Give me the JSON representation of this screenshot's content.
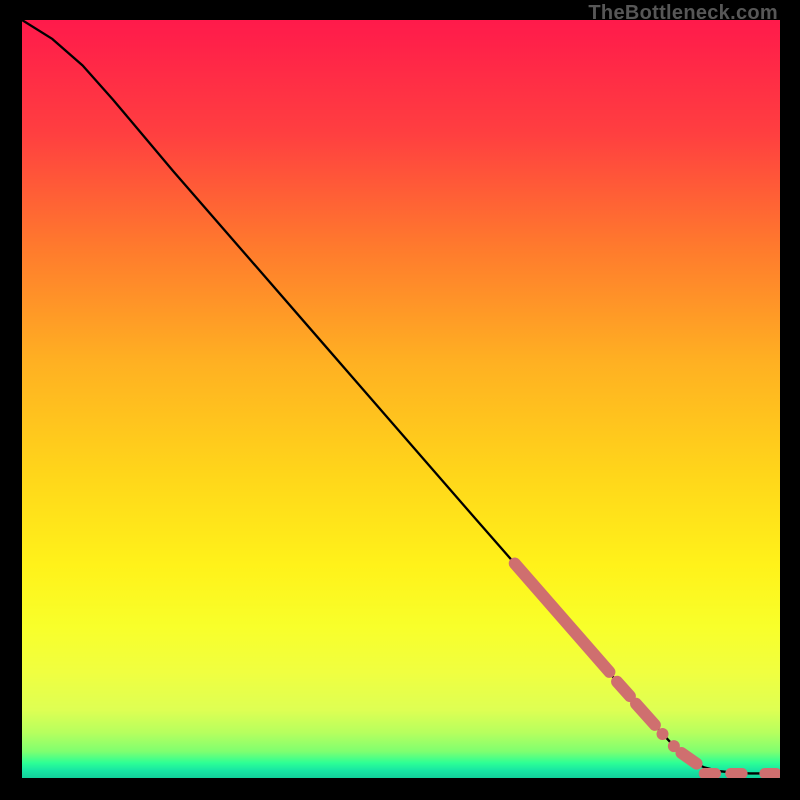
{
  "brand": "TheBottleneck.com",
  "chart_data": {
    "type": "line",
    "title": "",
    "xlabel": "",
    "ylabel": "",
    "xlim": [
      0,
      100
    ],
    "ylim": [
      0,
      100
    ],
    "grid": false,
    "legend": false,
    "series": [
      {
        "name": "curve",
        "x": [
          0,
          4,
          8,
          12,
          20,
          30,
          40,
          50,
          60,
          65,
          70,
          72,
          74,
          76,
          78,
          80,
          82,
          84,
          85,
          86,
          87,
          88,
          89,
          90,
          92,
          94,
          96,
          98,
          100
        ],
        "y": [
          100,
          97.5,
          94.0,
          89.5,
          80.0,
          68.5,
          57.0,
          45.5,
          34.0,
          28.3,
          22.5,
          20.2,
          17.9,
          15.6,
          13.3,
          11.0,
          8.7,
          6.4,
          5.3,
          4.2,
          3.3,
          2.5,
          1.9,
          1.4,
          0.9,
          0.7,
          0.6,
          0.6,
          0.6
        ],
        "color": "#000000",
        "stroke_width": 2.3
      }
    ],
    "markers": [
      {
        "name": "run-segment-1",
        "color": "#cf6f6f",
        "stroke_width": 12,
        "cap": "round",
        "points_x": [
          65.0,
          77.5
        ],
        "points_y": [
          28.3,
          14.0
        ]
      },
      {
        "name": "run-segment-2",
        "color": "#cf6f6f",
        "stroke_width": 12,
        "cap": "round",
        "points_x": [
          78.5,
          80.2
        ],
        "points_y": [
          12.7,
          10.8
        ]
      },
      {
        "name": "run-segment-3",
        "color": "#cf6f6f",
        "stroke_width": 12,
        "cap": "round",
        "points_x": [
          81.0,
          83.5
        ],
        "points_y": [
          9.8,
          7.0
        ]
      },
      {
        "name": "dot-1",
        "shape": "circle",
        "color": "#cf6f6f",
        "r": 6,
        "cx": 84.5,
        "cy": 5.8
      },
      {
        "name": "dot-2",
        "shape": "circle",
        "color": "#cf6f6f",
        "r": 6,
        "cx": 86.0,
        "cy": 4.2
      },
      {
        "name": "run-segment-4",
        "color": "#cf6f6f",
        "stroke_width": 12,
        "cap": "round",
        "points_x": [
          87.0,
          89.0
        ],
        "points_y": [
          3.3,
          1.9
        ]
      },
      {
        "name": "dash-1",
        "color": "#cf6f6f",
        "stroke_width": 11,
        "cap": "round",
        "points_x": [
          90.0,
          91.5
        ],
        "points_y": [
          0.6,
          0.6
        ]
      },
      {
        "name": "dash-2",
        "color": "#cf6f6f",
        "stroke_width": 11,
        "cap": "round",
        "points_x": [
          93.5,
          95.0
        ],
        "points_y": [
          0.6,
          0.6
        ]
      },
      {
        "name": "dash-3",
        "color": "#cf6f6f",
        "stroke_width": 11,
        "cap": "round",
        "points_x": [
          98.0,
          99.5
        ],
        "points_y": [
          0.6,
          0.6
        ]
      }
    ]
  }
}
